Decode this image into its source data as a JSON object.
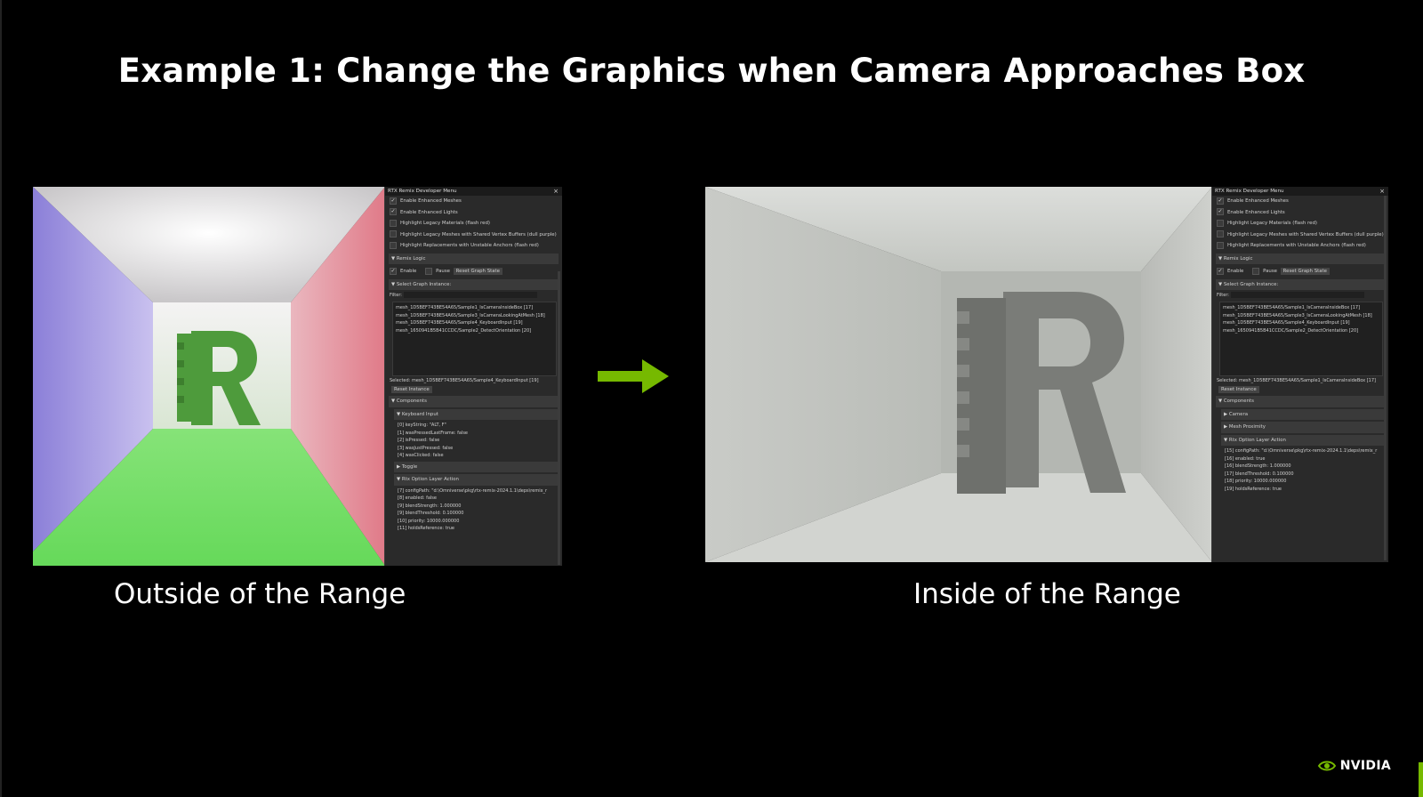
{
  "slide": {
    "title": "Example 1: Change the Graphics when Camera Approaches Box",
    "caption_left": "Outside of the Range",
    "caption_right": "Inside of the Range",
    "brand": "NVIDIA",
    "accent_color": "#76b900"
  },
  "panel_left": {
    "title": "RTX Remix Developer Menu",
    "enhanced_meshes": "Enable Enhanced Meshes",
    "enhanced_lights": "Enable Enhanced Lights",
    "highlight_legacy_materials": "Highlight Legacy Materials (flash red)",
    "highlight_legacy_meshes": "Highlight Legacy Meshes with Shared Vertex Buffers (dull purple)",
    "highlight_replacements": "Highlight Replacements with Unstable Anchors (flash red)",
    "remix_logic": "Remix Logic",
    "enable": "Enable",
    "pause": "Pause",
    "reset_graph_state": "Reset Graph State",
    "select_graph_instance": "Select Graph Instance:",
    "filter": "Filter:",
    "instances": [
      "mesh_1D5BEF743BE54A65/Sample1_IsCameraInsideBox [17]",
      "mesh_1D5BEF743BE54A65/Sample3_IsCameraLookingAtMesh [18]",
      "mesh_1D5BEF743BE54A65/Sample4_KeyboardInput [19]",
      "mesh_1650941B5B41CCDC/Sample2_DetectOrientation [20]"
    ],
    "selected": "Selected: mesh_1D5BEF743BE54A65/Sample4_KeyboardInput [19]",
    "reset_instance": "Reset Instance",
    "components": "Components",
    "keyboard_input": "Keyboard Input",
    "keyboard_props": [
      "[0] keyString: \"ALT, F\"",
      "[1] wasPressedLastFrame: false",
      "[2] isPressed: false",
      "[3] wasJustPressed: false",
      "[4] wasClicked: false"
    ],
    "toggle": "Toggle",
    "rtx_option": "Rtx Option Layer Action",
    "rtx_props": [
      "[7] configPath: \"d:\\Omniverse\\pkg\\rtx-remix-2024.1.1\\deps\\remix_r",
      "[8] enabled: false",
      "[9] blendStrength: 1.000000",
      "[9] blendThreshold: 0.100000",
      "[10] priority: 10000.000000",
      "[11] holdsReference: true"
    ]
  },
  "panel_right": {
    "title": "RTX Remix Developer Menu",
    "enhanced_meshes": "Enable Enhanced Meshes",
    "enhanced_lights": "Enable Enhanced Lights",
    "highlight_legacy_materials": "Highlight Legacy Materials (flash red)",
    "highlight_legacy_meshes": "Highlight Legacy Meshes with Shared Vertex Buffers (dull purple)",
    "highlight_replacements": "Highlight Replacements with Unstable Anchors (flash red)",
    "remix_logic": "Remix Logic",
    "enable": "Enable",
    "pause": "Pause",
    "reset_graph_state": "Reset Graph State",
    "select_graph_instance": "Select Graph Instance:",
    "filter": "Filter:",
    "instances": [
      "mesh_1D5BEF743BE54A65/Sample1_IsCameraInsideBox [17]",
      "mesh_1D5BEF743BE54A65/Sample3_IsCameraLookingAtMesh [18]",
      "mesh_1D5BEF743BE54A65/Sample4_KeyboardInput [19]",
      "mesh_1650941B5B41CCDC/Sample2_DetectOrientation [20]"
    ],
    "selected": "Selected: mesh_1D5BEF743BE54A65/Sample1_IsCameraInsideBox [17]",
    "reset_instance": "Reset Instance",
    "components": "Components",
    "camera": "Camera",
    "mesh_proximity": "Mesh Proximity",
    "rtx_option": "Rtx Option Layer Action",
    "rtx_props": [
      "[15] configPath: \"d:\\Omniverse\\pkg\\rtx-remix-2024.1.1\\deps\\remix_r",
      "[16] enabled: true",
      "[16] blendStrength: 1.000000",
      "[17] blendThreshold: 0.100000",
      "[18] priority: 10000.000000",
      "[19] holdsReference: true"
    ]
  }
}
